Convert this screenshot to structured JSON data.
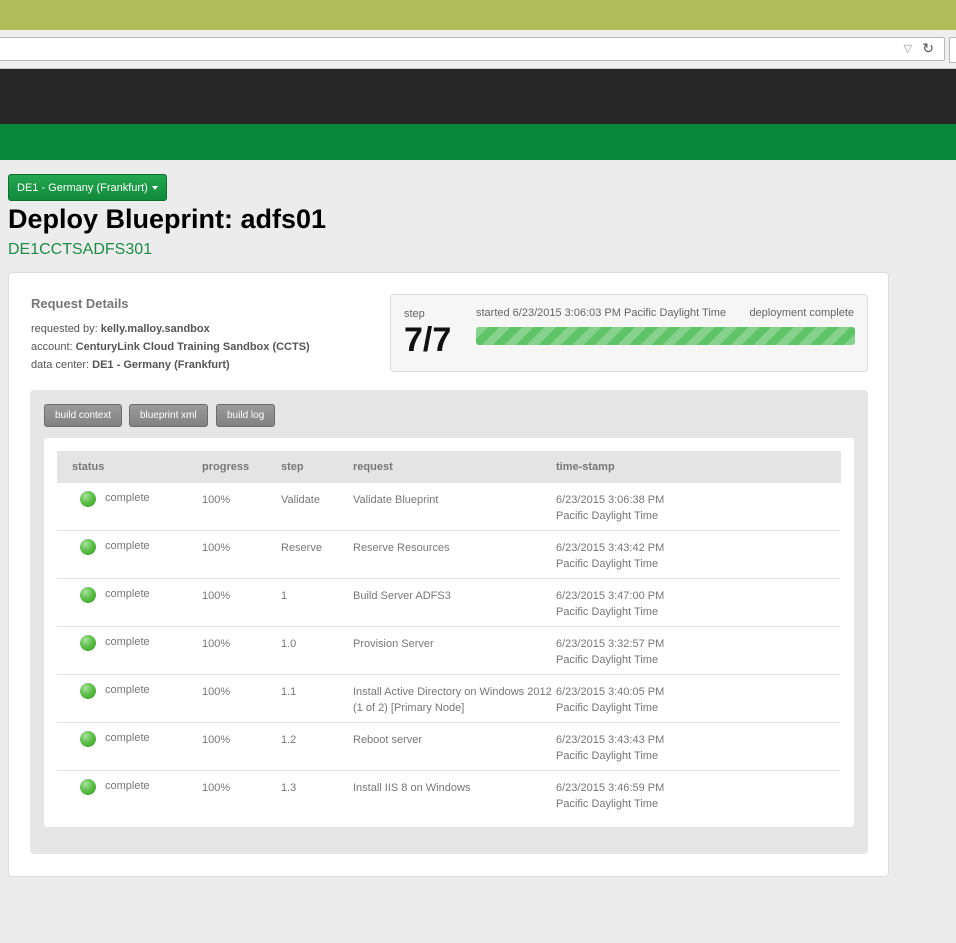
{
  "browser": {
    "address_value": "",
    "dropdown_glyph": "▽",
    "reload_glyph": "↻"
  },
  "header": {
    "datacenter_button": "DE1 - Germany (Frankfurt)",
    "page_title": "Deploy Blueprint: adfs01",
    "server_name": "DE1CCTSADFS301"
  },
  "request_details": {
    "heading": "Request Details",
    "requested_by_label": "requested by:",
    "requested_by": "kelly.malloy.sandbox",
    "account_label": "account:",
    "account": "CenturyLink Cloud Training Sandbox (CCTS)",
    "data_center_label": "data center:",
    "data_center": "DE1 - Germany (Frankfurt)"
  },
  "status": {
    "step_label": "step",
    "step_value": "7/7",
    "started": "started 6/23/2015 3:06:03 PM Pacific Daylight Time",
    "deployment_status": "deployment complete",
    "progress": 1.0
  },
  "tabs": [
    {
      "label": "build context"
    },
    {
      "label": "blueprint xml"
    },
    {
      "label": "build log"
    }
  ],
  "table": {
    "columns": [
      "status",
      "progress",
      "step",
      "request",
      "time-stamp"
    ],
    "rows": [
      {
        "status": "complete",
        "progress": "100%",
        "step": "Validate",
        "request": "Validate Blueprint",
        "time": "6/23/2015 3:06:38 PM",
        "tz": "Pacific Daylight Time"
      },
      {
        "status": "complete",
        "progress": "100%",
        "step": "Reserve",
        "request": "Reserve Resources",
        "time": "6/23/2015 3:43:42 PM",
        "tz": "Pacific Daylight Time"
      },
      {
        "status": "complete",
        "progress": "100%",
        "step": "1",
        "request": "Build Server ADFS3",
        "time": "6/23/2015 3:47:00 PM",
        "tz": "Pacific Daylight Time"
      },
      {
        "status": "complete",
        "progress": "100%",
        "step": "1.0",
        "request": "Provision Server",
        "time": "6/23/2015 3:32:57 PM",
        "tz": "Pacific Daylight Time"
      },
      {
        "status": "complete",
        "progress": "100%",
        "step": "1.1",
        "request": "Install Active Directory on Windows 2012 (1 of 2) [Primary Node]",
        "time": "6/23/2015 3:40:05 PM",
        "tz": "Pacific Daylight Time"
      },
      {
        "status": "complete",
        "progress": "100%",
        "step": "1.2",
        "request": "Reboot server",
        "time": "6/23/2015 3:43:43 PM",
        "tz": "Pacific Daylight Time"
      },
      {
        "status": "complete",
        "progress": "100%",
        "step": "1.3",
        "request": "Install IIS 8 on Windows",
        "time": "6/23/2015 3:46:59 PM",
        "tz": "Pacific Daylight Time"
      }
    ]
  },
  "colors": {
    "titlebar": "#b0bc58",
    "topnav": "#262626",
    "subnav": "#08883a",
    "accent_green": "#1e8c46",
    "status_complete": "#5ebe48"
  }
}
